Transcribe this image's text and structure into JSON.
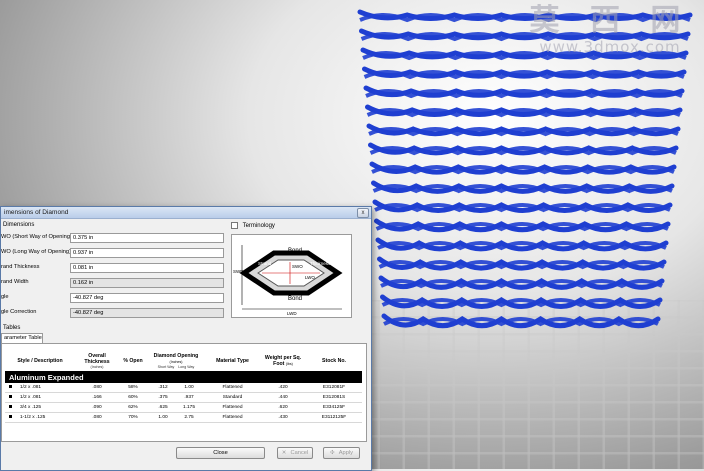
{
  "watermark": {
    "title": "莫 西 网",
    "url": "www.3dmox.com"
  },
  "dialog": {
    "title": "imensions of Diamond",
    "close_glyph": "x",
    "dimensions_label": "Dimensions",
    "fields": [
      {
        "label": "WO (Short Way of Opening)",
        "value": "0.375 in",
        "readonly": false
      },
      {
        "label": "WO (Long Way of Opening)",
        "value": "0.937 in",
        "readonly": false
      },
      {
        "label": "rand Thickness",
        "value": "0.081 in",
        "readonly": false
      },
      {
        "label": "rand Width",
        "value": "0.162 in",
        "readonly": true
      },
      {
        "label": "gle",
        "value": "-40.827 deg",
        "readonly": false
      },
      {
        "label": "gle Correction",
        "value": "-40.827 deg",
        "readonly": true
      }
    ],
    "terminology": {
      "label": "Terminology",
      "diagram_labels": {
        "bond_top": "Bond",
        "bond_bottom": "Bond",
        "strand": "Strand",
        "thickness": "Thickness",
        "swo": "SWO",
        "lwo": "LWO",
        "swd": "SWD",
        "lwd": "LWD"
      }
    },
    "tables_label": "Tables",
    "tab_label": "arameter Table",
    "table": {
      "headers": [
        {
          "main": "Style / Description",
          "sub": ""
        },
        {
          "main": "Overall Thickness",
          "sub": "(Inches)"
        },
        {
          "main": "% Open",
          "sub": ""
        },
        {
          "main": "Diamond Opening",
          "sub": "(Inches)",
          "subcols": [
            "Short Way",
            "Long Way"
          ]
        },
        {
          "main": "Material Type",
          "sub": ""
        },
        {
          "main": "Weight per Sq. Foot",
          "sub": "(lbs)"
        },
        {
          "main": "Stock No.",
          "sub": ""
        }
      ],
      "group": "Aluminum Expanded",
      "rows": [
        {
          "desc": "1/2 x .081",
          "thickness": ".080",
          "open": "58%",
          "short": ".312",
          "long": "1.00",
          "material": "Flattened",
          "weight": ".420",
          "stock": "E312081F"
        },
        {
          "desc": "1/2 x .081",
          "thickness": ".166",
          "open": "60%",
          "short": ".375",
          "long": ".937",
          "material": "Standard",
          "weight": ".440",
          "stock": "E312081S"
        },
        {
          "desc": "3/4 x .125",
          "thickness": ".090",
          "open": "62%",
          "short": ".625",
          "long": "1.175",
          "material": "Flattened",
          "weight": ".620",
          "stock": "E334125F"
        },
        {
          "desc": "1-1/2 x .125",
          "thickness": ".080",
          "open": "70%",
          "short": "1.00",
          "long": "2.75",
          "material": "Flattened",
          "weight": ".430",
          "stock": "E3112125F"
        }
      ]
    },
    "buttons": {
      "close": "Close",
      "cancel": "Cancel",
      "apply": "Apply",
      "cancel_icon": "✕",
      "apply_icon": "✣"
    }
  },
  "colors": {
    "mesh": "#1f3fd1",
    "titlebar": "#c7d7ee",
    "group_row": "#000000"
  },
  "icons": [
    "close-icon",
    "checkbox-icon",
    "cancel-icon",
    "apply-icon"
  ]
}
